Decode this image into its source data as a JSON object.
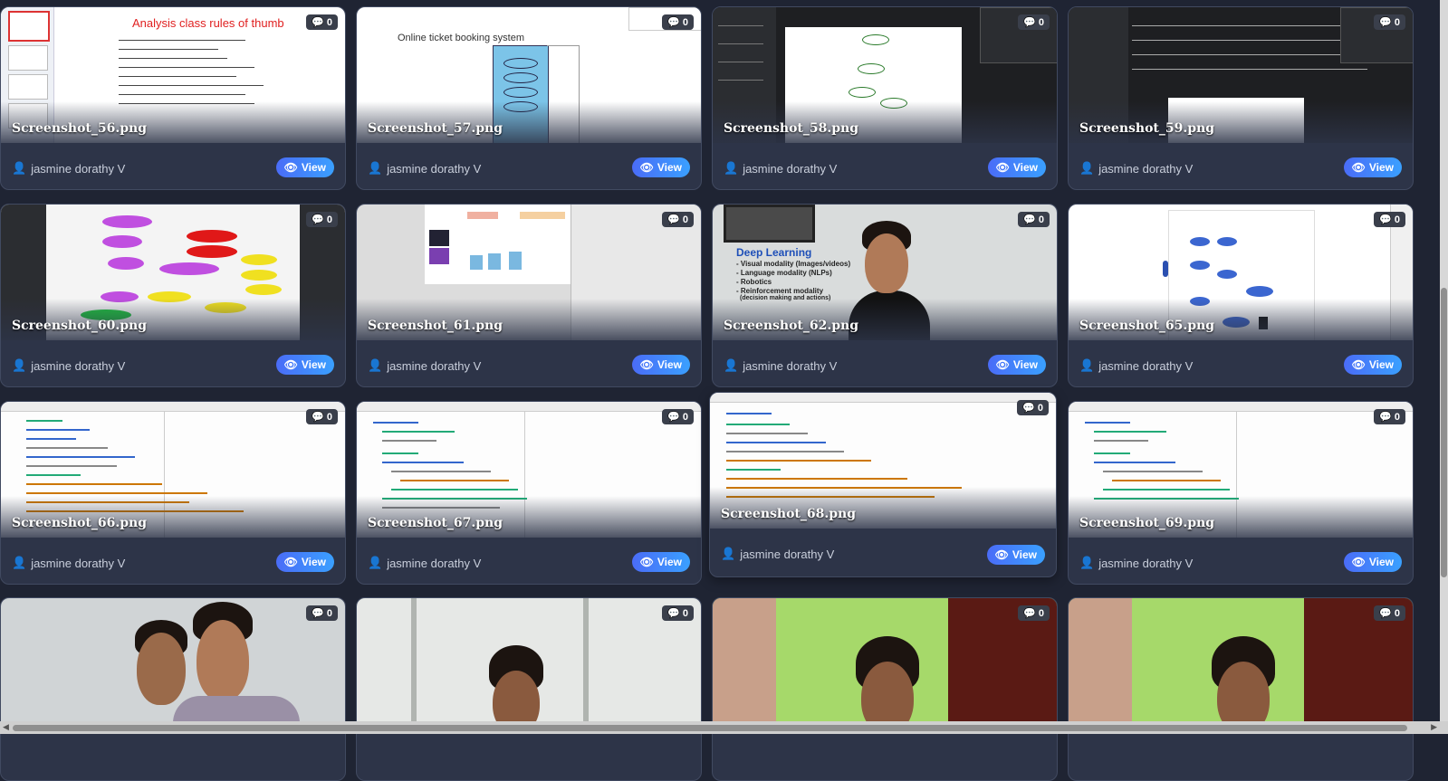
{
  "cards": [
    {
      "file": "Screenshot_56.png",
      "comments": "0",
      "author": "jasmine dorathy V",
      "view": "View",
      "thumb_text": "Analysis class rules of thumb"
    },
    {
      "file": "Screenshot_57.png",
      "comments": "0",
      "author": "jasmine dorathy V",
      "view": "View",
      "thumb_text": "Online ticket booking system"
    },
    {
      "file": "Screenshot_58.png",
      "comments": "0",
      "author": "jasmine dorathy V",
      "view": "View"
    },
    {
      "file": "Screenshot_59.png",
      "comments": "0",
      "author": "jasmine dorathy V",
      "view": "View"
    },
    {
      "file": "Screenshot_60.png",
      "comments": "0",
      "author": "jasmine dorathy V",
      "view": "View"
    },
    {
      "file": "Screenshot_61.png",
      "comments": "0",
      "author": "jasmine dorathy V",
      "view": "View"
    },
    {
      "file": "Screenshot_62.png",
      "comments": "0",
      "author": "jasmine dorathy V",
      "view": "View",
      "thumb_text": "Deep Learning",
      "thumb_bullets": [
        "- Visual modality (Images/videos)",
        "- Language modality (NLPs)",
        "- Robotics",
        "- Reinforcement modality",
        "(decision making and actions)"
      ]
    },
    {
      "file": "Screenshot_65.png",
      "comments": "0",
      "author": "jasmine dorathy V",
      "view": "View"
    },
    {
      "file": "Screenshot_66.png",
      "comments": "0",
      "author": "jasmine dorathy V",
      "view": "View"
    },
    {
      "file": "Screenshot_67.png",
      "comments": "0",
      "author": "jasmine dorathy V",
      "view": "View"
    },
    {
      "file": "Screenshot_68.png",
      "comments": "0",
      "author": "jasmine dorathy V",
      "view": "View"
    },
    {
      "file": "Screenshot_69.png",
      "comments": "0",
      "author": "jasmine dorathy V",
      "view": "View"
    },
    {
      "comments": "0"
    },
    {
      "comments": "0"
    },
    {
      "comments": "0"
    },
    {
      "comments": "0"
    }
  ],
  "icons": {
    "comment": "comments-icon",
    "user": "user-icon",
    "view": "eye-icon"
  },
  "colors": {
    "page_bg": "#1f2433",
    "card_bg": "#2d3448",
    "view_grad_start": "#4a6cf7",
    "view_grad_end": "#3aa0ff"
  }
}
